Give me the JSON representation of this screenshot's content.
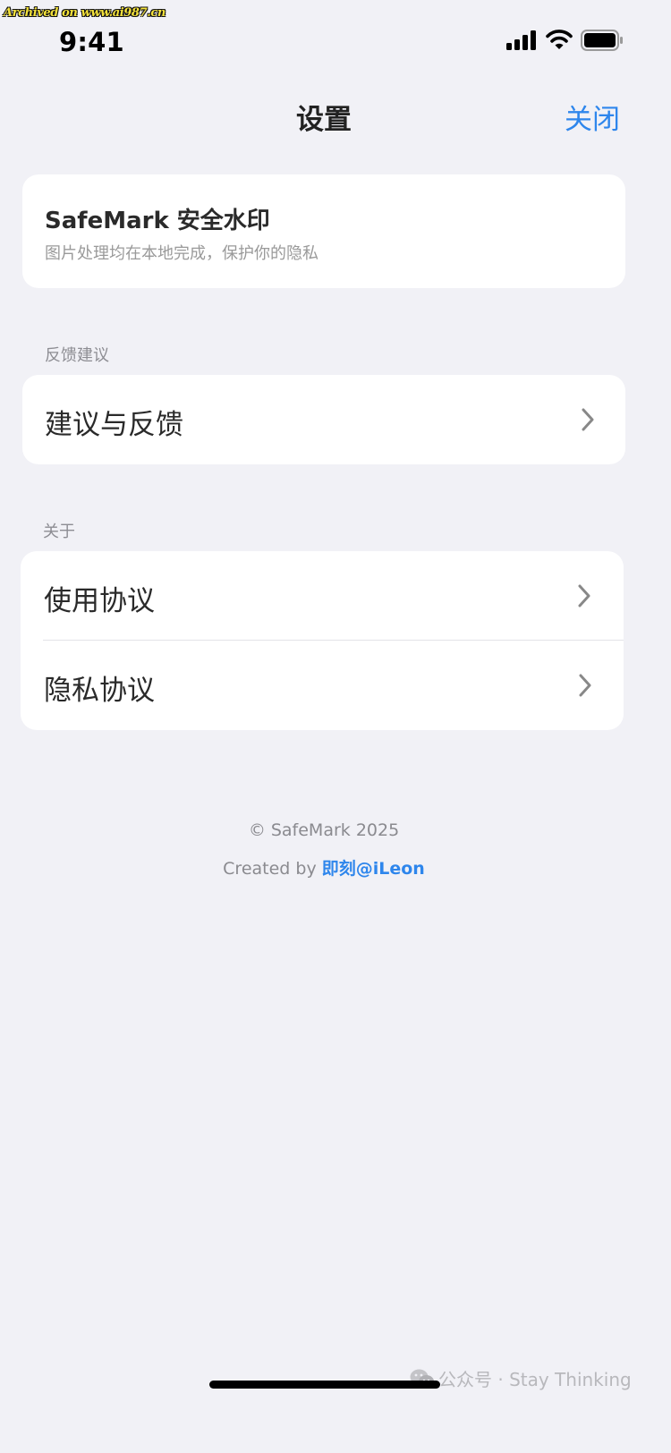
{
  "watermark_top": "Archived on www.ai987.cn",
  "status_bar": {
    "time": "9:41"
  },
  "nav": {
    "title": "设置",
    "close_label": "关闭"
  },
  "app_card": {
    "name": "SafeMark 安全水印",
    "subtitle": "图片处理均在本地完成，保护你的隐私"
  },
  "sections": {
    "feedback": {
      "label": "反馈建议",
      "items": [
        {
          "label": "建议与反馈"
        }
      ]
    },
    "about": {
      "label": "关于",
      "items": [
        {
          "label": "使用协议"
        },
        {
          "label": "隐私协议"
        }
      ]
    }
  },
  "footer": {
    "copyright": "© SafeMark 2025",
    "created_by_prefix": "Created by ",
    "created_by_link": "即刻@iLeon"
  },
  "watermark_bottom": "公众号 · Stay Thinking",
  "colors": {
    "background": "#f1f1f6",
    "card": "#ffffff",
    "accent_blue": "#2e86ec",
    "secondary_text": "#8d8d93"
  }
}
